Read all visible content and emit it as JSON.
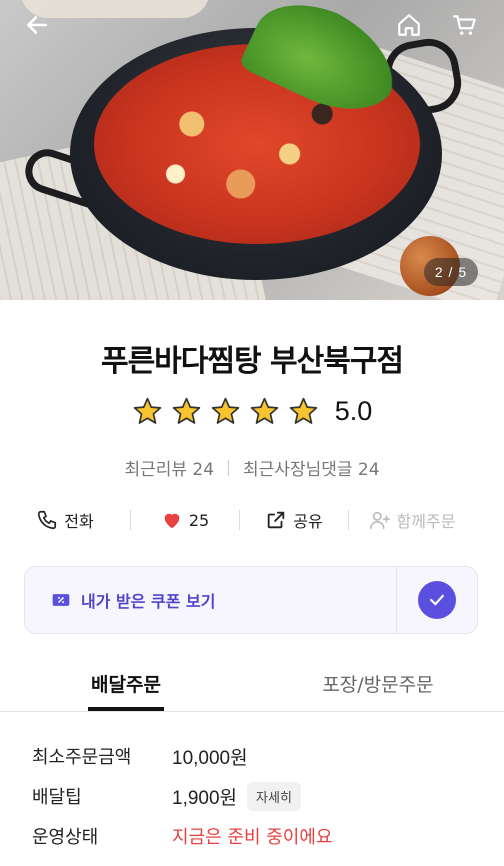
{
  "header": {
    "back_icon": "arrow-left-icon",
    "home_icon": "home-icon",
    "cart_icon": "cart-icon",
    "image_counter": "2 / 5"
  },
  "store": {
    "name": "푸른바다찜탕 부산북구점",
    "rating": "5.0",
    "rating_stars": 5,
    "recent_reviews_label": "최근리뷰 24",
    "owner_replies_label": "최근사장님댓글 24"
  },
  "actions": {
    "call_label": "전화",
    "likes_count": "25",
    "share_label": "공유",
    "group_order_label": "함께주문"
  },
  "coupon": {
    "label": "내가 받은 쿠폰 보기"
  },
  "tabs": [
    {
      "label": "배달주문",
      "active": true
    },
    {
      "label": "포장/방문주문",
      "active": false
    }
  ],
  "info": {
    "min_order_label": "최소주문금액",
    "min_order_value": "10,000원",
    "delivery_tip_label": "배달팁",
    "delivery_tip_value": "1,900원",
    "detail_button": "자세히",
    "status_label": "운영상태",
    "status_value": "지금은 준비 중이에요"
  },
  "colors": {
    "accent": "#5b4fe0",
    "coupon_text": "#5146c8",
    "star": "#f7c32e",
    "heart": "#e8413f",
    "status_red": "#e8413f"
  }
}
